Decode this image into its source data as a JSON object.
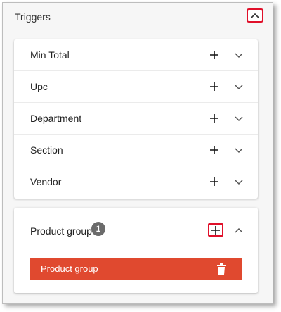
{
  "panel": {
    "title": "Triggers",
    "collapse_icon": "chevron-up-icon"
  },
  "triggers": [
    {
      "label": "Min Total"
    },
    {
      "label": "Upc"
    },
    {
      "label": "Department"
    },
    {
      "label": "Section"
    },
    {
      "label": "Vendor"
    }
  ],
  "product_group": {
    "label": "Product group",
    "count": "1",
    "selected": [
      {
        "label": "Product group"
      }
    ]
  },
  "colors": {
    "highlight": "#e0102a",
    "chip": "#e0492f",
    "badge": "#6b6b6b"
  }
}
